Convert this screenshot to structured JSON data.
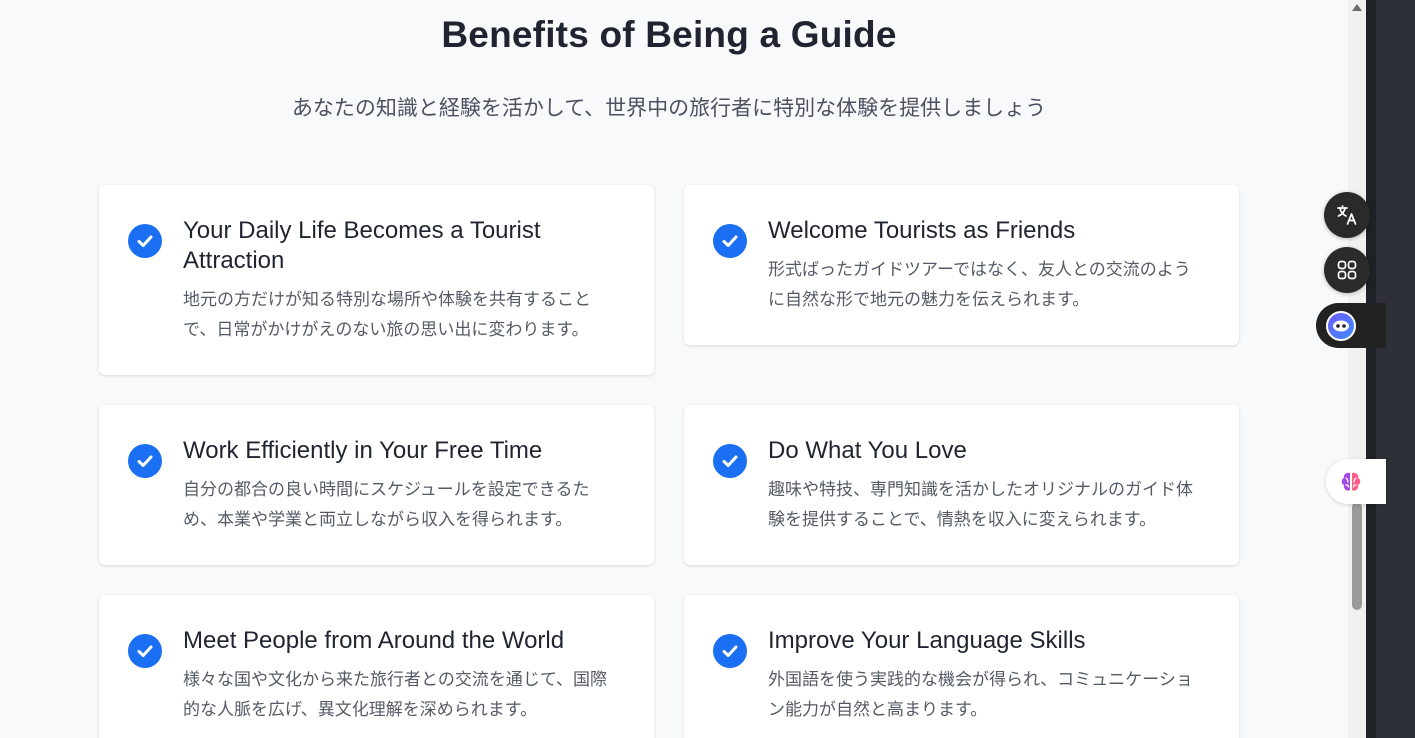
{
  "header": {
    "title": "Benefits of Being a Guide",
    "subtitle": "あなたの知識と経験を活かして、世界中の旅行者に特別な体験を提供しましょう"
  },
  "cards": [
    {
      "title": "Your Daily Life Becomes a Tourist Attraction",
      "desc": "地元の方だけが知る特別な場所や体験を共有することで、日常がかけがえのない旅の思い出に変わります。",
      "icon": "check-circle-icon"
    },
    {
      "title": "Welcome Tourists as Friends",
      "desc": "形式ばったガイドツアーではなく、友人との交流のように自然な形で地元の魅力を伝えられます。",
      "icon": "check-circle-icon"
    },
    {
      "title": "Work Efficiently in Your Free Time",
      "desc": "自分の都合の良い時間にスケジュールを設定できるため、本業や学業と両立しながら収入を得られます。",
      "icon": "check-circle-icon"
    },
    {
      "title": "Do What You Love",
      "desc": "趣味や特技、専門知識を活かしたオリジナルのガイド体験を提供することで、情熱を収入に変えられます。",
      "icon": "check-circle-icon"
    },
    {
      "title": "Meet People from Around the World",
      "desc": "様々な国や文化から来た旅行者との交流を通じて、国際的な人脈を広げ、異文化理解を深められます。",
      "icon": "check-circle-icon"
    },
    {
      "title": "Improve Your Language Skills",
      "desc": "外国語を使う実践的な機会が得られ、コミュニケーション能力が自然と高まります。",
      "icon": "check-circle-icon"
    }
  ],
  "side_tools": {
    "translate_icon": "translate-icon",
    "apps_icon": "apps-grid-icon",
    "assistant_icon": "assistant-face-icon",
    "brain_icon": "brain-icon"
  },
  "colors": {
    "accent": "#1a6ff2",
    "background": "#f8f9fb",
    "card": "#ffffff"
  }
}
